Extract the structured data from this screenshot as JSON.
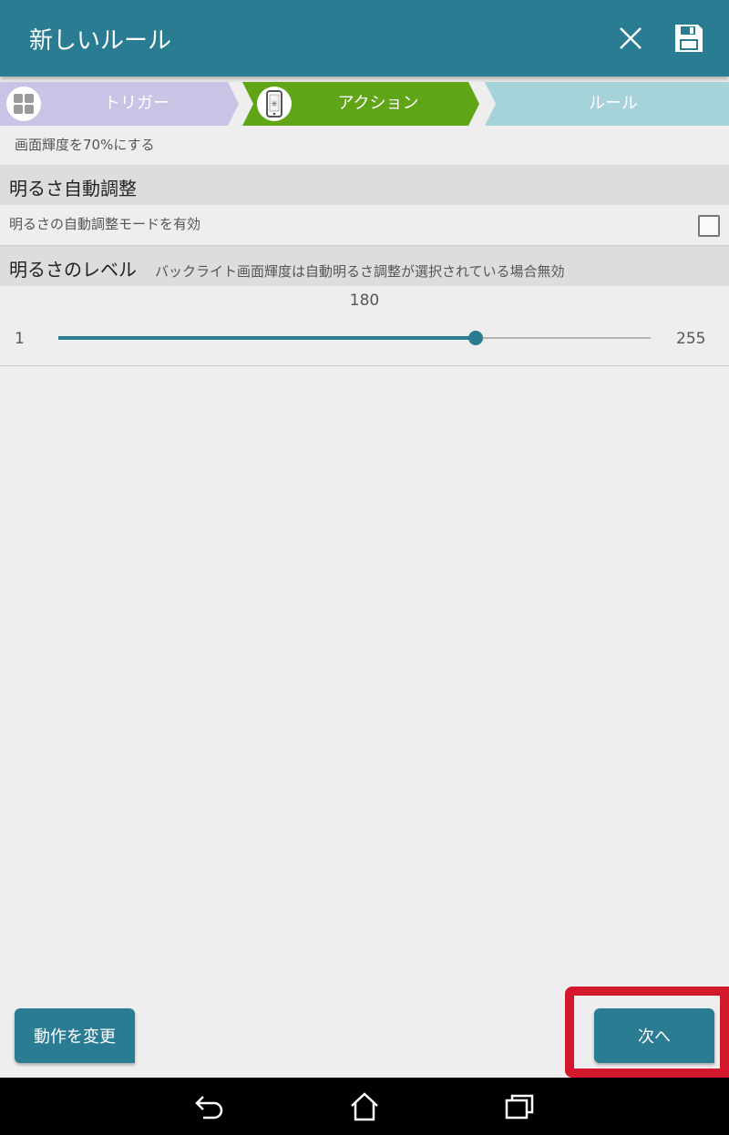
{
  "header": {
    "title": "新しいルール",
    "close_icon": "close-icon",
    "save_icon": "floppy-disk-icon"
  },
  "steps": [
    {
      "label": "トリガー",
      "icon": "grid-icon",
      "color": "#c9c3e6",
      "state": "done"
    },
    {
      "label": "アクション",
      "icon": "phone-brightness-icon",
      "color": "#5fa516",
      "state": "current"
    },
    {
      "label": "ルール",
      "color": "#a6d2da",
      "state": "pending"
    }
  ],
  "summary": "画面輝度を70%にする",
  "auto_brightness": {
    "title": "明るさ自動調整",
    "option_label": "明るさの自動調整モードを有効",
    "checked": false
  },
  "brightness_level": {
    "title": "明るさのレベル",
    "note": "バックライト画面輝度は自動明るさ調整が選択されている場合無効",
    "value": "180",
    "min": "1",
    "max": "255"
  },
  "buttons": {
    "change_action": "動作を変更",
    "next": "次へ"
  },
  "colors": {
    "accent": "#2a7c92",
    "highlight": "#d3182e",
    "background": "#eeeeee"
  },
  "navbar": {
    "back_icon": "back-icon",
    "home_icon": "home-icon",
    "recents_icon": "recents-icon"
  }
}
